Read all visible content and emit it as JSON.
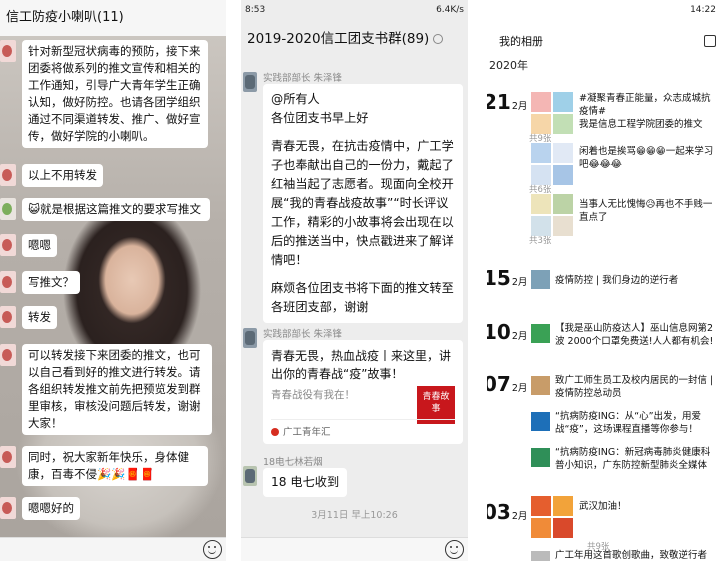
{
  "panel1": {
    "title": "信工防疫小喇叭(11)",
    "messages": [
      {
        "text": "针对新型冠状病毒的预防，接下来团委将做系列的推文宣传和相关的工作通知，引导广大青年学生正确认知，做好防控。也请各团学组织通过不同渠道转发、推广、做好宣传，做好学院的小喇叭。"
      },
      {
        "text": "以上不用转发"
      },
      {
        "text": "😺就是根据这篇推文的要求写推文"
      },
      {
        "text": "嗯嗯"
      },
      {
        "text": "写推文？"
      },
      {
        "text": "转发"
      },
      {
        "text": "可以转发接下来团委的推文，也可以自己看到好的推文进行转发。请各组织转发推文前先把预览发到群里审核，审核没问题后转发，谢谢大家！"
      },
      {
        "text": "同时，祝大家新年快乐，身体健康，百毒不侵🎉🎉🧧🧧"
      },
      {
        "text": "嗯嗯好的"
      }
    ]
  },
  "panel2": {
    "status": {
      "time": "8:53",
      "speed": "6.4K/s"
    },
    "title": "2019-2020信工团支书群(89)",
    "sender1": "实践部部长 朱泽锋",
    "msg1": {
      "p1": "@所有人\n各位团支书早上好",
      "p2": "青春无畏，在抗击疫情中，广工学子也奉献出自己的一份力，戴起了红袖当起了志愿者。现面向全校开展“我的青春战疫故事”“时长评议工作，精彩的小故事将会出现在以后的推送当中，快点戳进来了解详情吧！",
      "p3": "麻烦各位团支书将下面的推文转至各班团支部，谢谢"
    },
    "sender2": "实践部部长 朱泽锋",
    "card": {
      "title": "青春无畏，热血战疫丨来这里，讲出你的青春战“疫”故事！",
      "desc": "青春战役有我在！",
      "thumb": "青春故事",
      "source": "广工青年汇"
    },
    "sender3": "18电七林若烟",
    "msg3": "18 电七收到",
    "timestamp": "3月11日 早上10:26"
  },
  "panel3": {
    "status": {
      "time": "14:22"
    },
    "header": "我的相册",
    "year": "2020年",
    "days": [
      {
        "d": "21",
        "m": "2月"
      },
      {
        "d": "15",
        "m": "2月"
      },
      {
        "d": "10",
        "m": "2月"
      },
      {
        "d": "07",
        "m": "2月"
      },
      {
        "d": "03",
        "m": "2月"
      }
    ],
    "posts": [
      {
        "text": "#凝聚青春正能量，众志成城抗疫情#",
        "sub": "我是信息工程学院团委的推文",
        "count": "共9张"
      },
      {
        "text": "闲着也是挨骂😁😁😁一起来学习吧😂😂😂",
        "count": "共6张"
      },
      {
        "text": "当事人无比愧悔😥再也不手贱一直点了",
        "count": "共3张"
      },
      {
        "text": "疫情防控 | 我们身边的逆行者"
      },
      {
        "text": "【我是巫山防疫达人】巫山信息网第2波 2000个口罩免费送!人人都有机会!"
      },
      {
        "text": "致广工师生员工及校内居民的一封信 | 疫情防控总动员"
      },
      {
        "text": "“抗病防疫ING：从“心”出发，用爱战“疫”，这场课程直播等你参与！"
      },
      {
        "text": "“抗病防疫ING：新冠病毒肺炎健康科普小知识，广东防控新型肺炎全媒体"
      },
      {
        "text": "武汉加油！",
        "count": "共9张"
      },
      {
        "text": "广工年用这首歌创歌曲，致敬逆行者"
      }
    ]
  }
}
